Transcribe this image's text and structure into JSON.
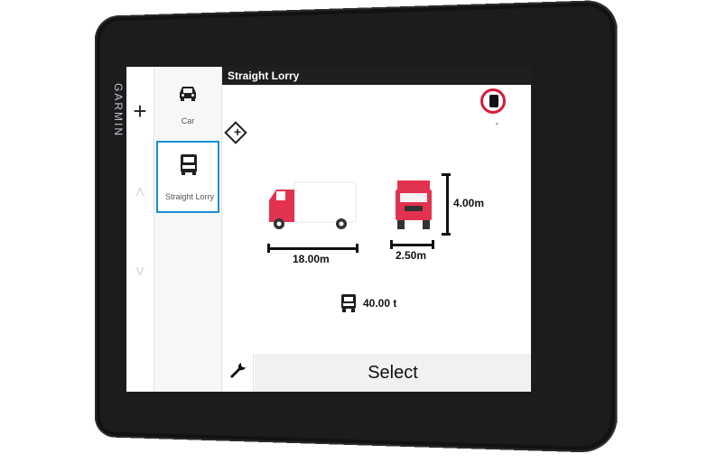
{
  "device": {
    "brand": "GARMIN"
  },
  "vehicle_list": {
    "items": [
      {
        "label": "Car",
        "icon": "car-icon",
        "selected": false
      },
      {
        "label": "Straight Lorry",
        "icon": "lorry-icon",
        "selected": true
      }
    ]
  },
  "header": {
    "title": "Straight Lorry"
  },
  "profile": {
    "restriction_badge_subtext": "-",
    "length": "18.00m",
    "width": "2.50m",
    "height": "4.00m",
    "weight": "40.00 t",
    "colors": {
      "truck_cab": "#e3324f",
      "truck_body": "#ffffff",
      "selected_border": "#1c8fd6",
      "restriction_red": "#d81b3a"
    }
  },
  "actions": {
    "select_label": "Select"
  }
}
